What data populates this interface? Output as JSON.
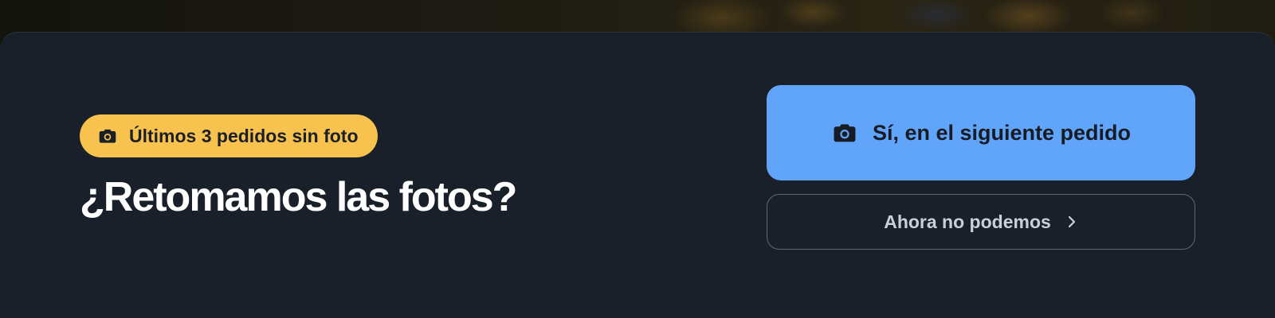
{
  "badge": {
    "icon": "camera-icon",
    "label": "Últimos 3 pedidos sin foto",
    "color": "#f7c24d"
  },
  "title": "¿Retomamos las fotos?",
  "primary_action": {
    "icon": "camera-icon",
    "label": "Sí, en el siguiente pedido",
    "color": "#60a5fa"
  },
  "secondary_action": {
    "label": "Ahora no podemos",
    "icon": "chevron-right-icon"
  },
  "colors": {
    "background": "#1a202a",
    "text_primary": "#ffffff",
    "text_muted": "#c9d0da"
  }
}
